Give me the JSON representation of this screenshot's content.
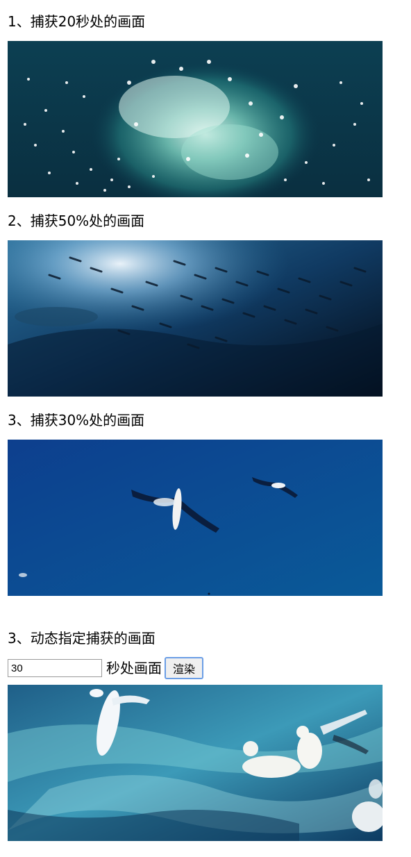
{
  "section1": {
    "heading": "1、捕获20秒处的画面",
    "image": "ocean-surface-gannets-diving-splash"
  },
  "section2": {
    "heading": "2、捕获50%处的画面",
    "image": "underwater-sardine-school"
  },
  "section3": {
    "heading": "3、捕获30%处的画面",
    "image": "gannets-flying-blue-sky"
  },
  "section4": {
    "heading": "3、动态指定捕获的画面",
    "input_value": "30",
    "suffix_label": "秒处画面",
    "button_label": "渲染",
    "image": "gannets-on-turbulent-water"
  },
  "colors": {
    "button_border": "#6b9ee6",
    "button_bg": "#efefef",
    "input_border": "#9a9a9a"
  }
}
